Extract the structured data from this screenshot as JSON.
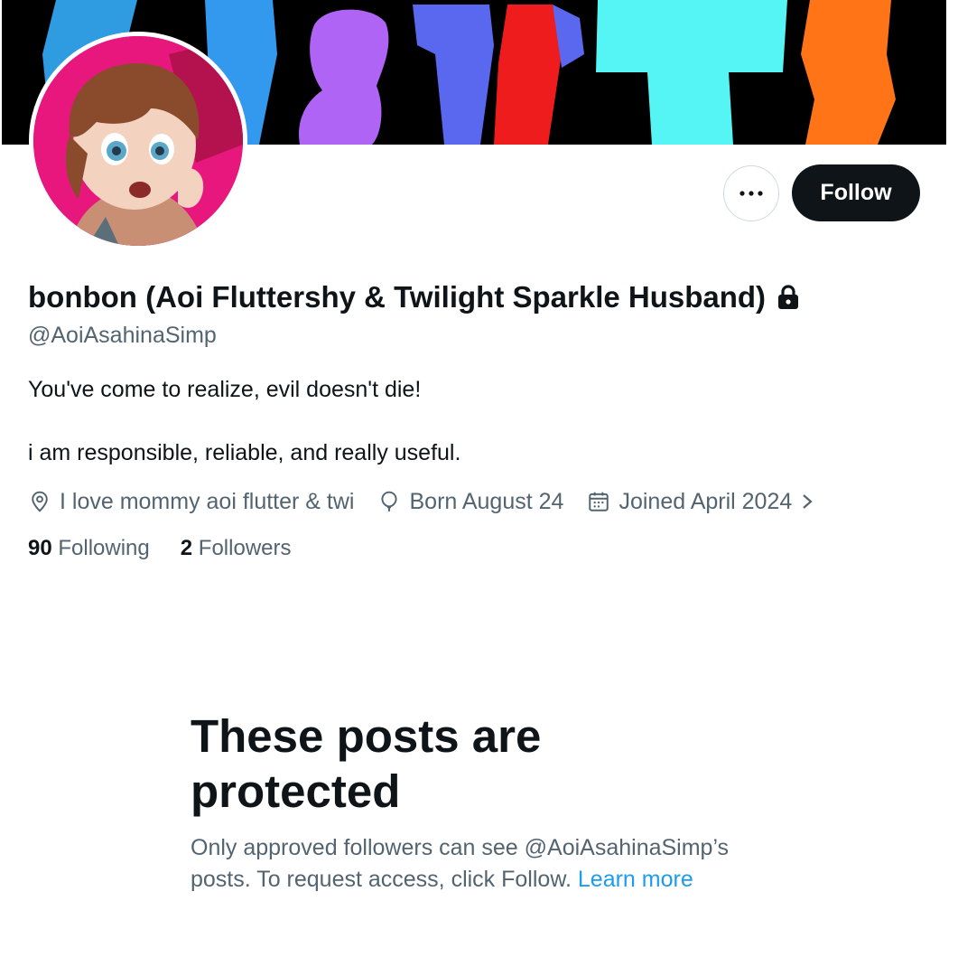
{
  "profile": {
    "display_name": "bonbon (Aoi Fluttershy & Twilight Sparkle Husband)",
    "handle": "@AoiAsahinaSimp",
    "bio_line1": "You've come to realize, evil doesn't die!",
    "bio_line2": "i am responsible, reliable, and really useful.",
    "location": "I love mommy aoi flutter & twi",
    "birthday": "Born August 24",
    "joined": "Joined April 2024",
    "following_count": "90",
    "following_label": "Following",
    "followers_count": "2",
    "followers_label": "Followers"
  },
  "actions": {
    "more_icon": "ellipsis-icon",
    "follow_label": "Follow"
  },
  "protected": {
    "title": "These posts are protected",
    "description": "Only approved followers can see @AoiAsahinaSimp’s posts. To request access, click Follow.",
    "link_label": "Learn more"
  },
  "colors": {
    "text_primary": "#0f1419",
    "text_secondary": "#536471",
    "link": "#1d9bf0",
    "button_dark": "#0f1419",
    "avatar_bg": "#e8177e"
  },
  "icons": {
    "lock": "lock-icon",
    "location": "location-pin-icon",
    "birthday": "balloon-icon",
    "joined": "calendar-icon",
    "joined_more": "chevron-right-icon"
  }
}
